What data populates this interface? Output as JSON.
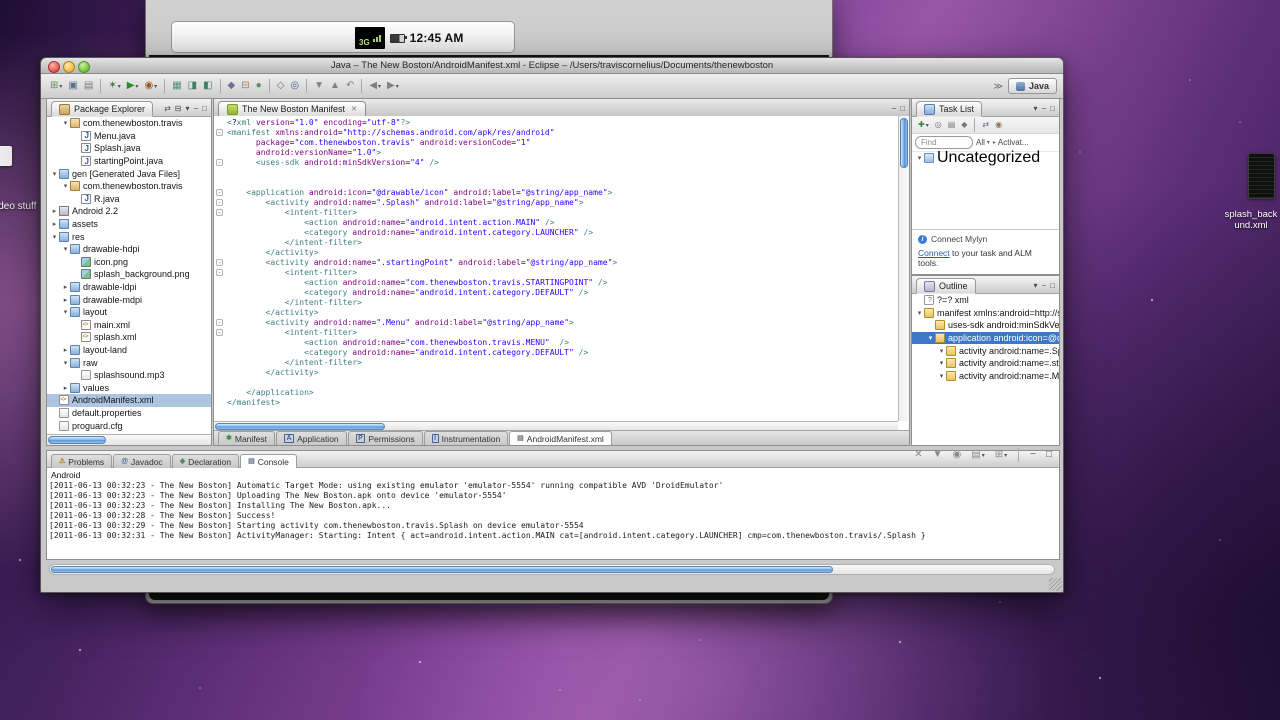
{
  "ui": {
    "menu": "▾",
    "min": "−",
    "max": "□",
    "close": "✕",
    "link": "⇄",
    "collapse_all": "⊟",
    "chevrons": "≫",
    "triangle_down": "▾",
    "triangle_right": "▸",
    "fold": "-"
  },
  "desktop": {
    "left_icon_label": "ideo stuff",
    "right_icon_label_1": "splash_back",
    "right_icon_label_2": "und.xml"
  },
  "emulator": {
    "time": "12:45 AM",
    "signal_label": "3G"
  },
  "window": {
    "title": "Java – The New Boston/AndroidManifest.xml - Eclipse – /Users/traviscornelius/Documents/thenewboston"
  },
  "toolbar": {
    "perspective_label": "Java",
    "icons": [
      {
        "name": "new-wizard",
        "g": "⊞",
        "c": "#6b8f5a",
        "arrow": true
      },
      {
        "name": "save",
        "g": "▣",
        "c": "#5a6f8f"
      },
      {
        "name": "print",
        "g": "▤",
        "c": "#7a7a7a",
        "sep": true
      },
      {
        "name": "debug",
        "g": "✶",
        "c": "#3f7a3f",
        "arrow": true
      },
      {
        "name": "run",
        "g": "▶",
        "c": "#2e8b2e",
        "arrow": true
      },
      {
        "name": "external-tools",
        "g": "◉",
        "c": "#a0522d",
        "arrow": true,
        "sep": true
      },
      {
        "name": "new-android-project",
        "g": "▦",
        "c": "#4f8f6f"
      },
      {
        "name": "android-sdk-manager",
        "g": "◨",
        "c": "#3f7f5f"
      },
      {
        "name": "android-virtual-device-manager",
        "g": "◧",
        "c": "#3f7f5f",
        "sep": true
      },
      {
        "name": "new-java-project",
        "g": "◆",
        "c": "#6f6f9f"
      },
      {
        "name": "new-package",
        "g": "⊟",
        "c": "#9f7f5f"
      },
      {
        "name": "new-class",
        "g": "●",
        "c": "#5f8f5f",
        "sep": true
      },
      {
        "name": "open-type",
        "g": "◇",
        "c": "#6f6f6f"
      },
      {
        "name": "search",
        "g": "◎",
        "c": "#44608f",
        "sep": true
      },
      {
        "name": "next-annotation",
        "g": "▼",
        "c": "#808080"
      },
      {
        "name": "previous-annotation",
        "g": "▲",
        "c": "#808080"
      },
      {
        "name": "last-edit-location",
        "g": "↶",
        "c": "#808080",
        "sep": true
      },
      {
        "name": "back",
        "g": "◀",
        "c": "#808080",
        "arrow": true
      },
      {
        "name": "forward",
        "g": "▶",
        "c": "#808080",
        "arrow": true
      }
    ]
  },
  "package_explorer": {
    "title": "Package Explorer",
    "tree": [
      {
        "d": 1,
        "icon": "package",
        "label": "com.thenewboston.travis",
        "exp": true
      },
      {
        "d": 2,
        "icon": "java",
        "label": "Menu.java"
      },
      {
        "d": 2,
        "icon": "java",
        "label": "Splash.java"
      },
      {
        "d": 2,
        "icon": "java",
        "label": "startingPoint.java"
      },
      {
        "d": 0,
        "icon": "folder",
        "label": "gen [Generated Java Files]",
        "exp": true
      },
      {
        "d": 1,
        "icon": "package",
        "label": "com.thenewboston.travis",
        "exp": true
      },
      {
        "d": 2,
        "icon": "java",
        "label": "R.java"
      },
      {
        "d": 0,
        "icon": "lib",
        "label": "Android 2.2",
        "exp": false
      },
      {
        "d": 0,
        "icon": "folder",
        "label": "assets",
        "exp": false
      },
      {
        "d": 0,
        "icon": "folder",
        "label": "res",
        "exp": true
      },
      {
        "d": 1,
        "icon": "folder",
        "label": "drawable-hdpi",
        "exp": true
      },
      {
        "d": 2,
        "icon": "img",
        "label": "icon.png"
      },
      {
        "d": 2,
        "icon": "img",
        "label": "splash_background.png"
      },
      {
        "d": 1,
        "icon": "folder",
        "label": "drawable-ldpi",
        "exp": false
      },
      {
        "d": 1,
        "icon": "folder",
        "label": "drawable-mdpi",
        "exp": false
      },
      {
        "d": 1,
        "icon": "folder",
        "label": "layout",
        "exp": true
      },
      {
        "d": 2,
        "icon": "xml",
        "label": "main.xml"
      },
      {
        "d": 2,
        "icon": "xml",
        "label": "splash.xml"
      },
      {
        "d": 1,
        "icon": "folder",
        "label": "layout-land",
        "exp": false
      },
      {
        "d": 1,
        "icon": "folder",
        "label": "raw",
        "exp": true
      },
      {
        "d": 2,
        "icon": "file",
        "label": "splashsound.mp3"
      },
      {
        "d": 1,
        "icon": "folder",
        "label": "values",
        "exp": false
      },
      {
        "d": 0,
        "icon": "xml",
        "label": "AndroidManifest.xml",
        "selected": true
      },
      {
        "d": 0,
        "icon": "file",
        "label": "default.properties"
      },
      {
        "d": 0,
        "icon": "file",
        "label": "proguard.cfg"
      }
    ]
  },
  "editor": {
    "tab_label": "The New Boston Manifest",
    "lines": [
      "<?xml version=\"1.0\" encoding=\"utf-8\"?>",
      "<manifest xmlns:android=\"http://schemas.android.com/apk/res/android\"",
      "      package=\"com.thenewboston.travis\" android:versionCode=\"1\"",
      "      android:versionName=\"1.0\">",
      "      <uses-sdk android:minSdkVersion=\"4\" />",
      "",
      "",
      "    <application android:icon=\"@drawable/icon\" android:label=\"@string/app_name\">",
      "        <activity android:name=\".Splash\" android:label=\"@string/app_name\">",
      "            <intent-filter>",
      "                <action android:name=\"android.intent.action.MAIN\" />",
      "                <category android:name=\"android.intent.category.LAUNCHER\" />",
      "            </intent-filter>",
      "        </activity>",
      "        <activity android:name=\".startingPoint\" android:label=\"@string/app_name\">",
      "            <intent-filter>",
      "                <action android:name=\"com.thenewboston.travis.STARTINGPOINT\" />",
      "                <category android:name=\"android.intent.category.DEFAULT\" />",
      "            </intent-filter>",
      "        </activity>",
      "        <activity android:name=\".Menu\" android:label=\"@string/app_name\">",
      "            <intent-filter>",
      "                <action android:name=\"com.thenewboston.travis.MENU\"  />",
      "                <category android:name=\"android.intent.category.DEFAULT\" />",
      "            </intent-filter>",
      "        </activity>",
      "",
      "    </application>",
      "</manifest>"
    ],
    "fold_lines": [
      1,
      4,
      7,
      8,
      9,
      14,
      15,
      20,
      21
    ],
    "bottom_tabs": [
      {
        "label": "Manifest",
        "g": "✱",
        "c": "#3f8f3f"
      },
      {
        "label": "Application",
        "g": "A",
        "c": "#3f5fa0",
        "boxed": true
      },
      {
        "label": "Permissions",
        "g": "P",
        "c": "#3f5fa0",
        "boxed": true
      },
      {
        "label": "Instrumentation",
        "g": "I",
        "c": "#3f5fa0",
        "boxed": true
      },
      {
        "label": "AndroidManifest.xml",
        "g": "▤",
        "c": "#5f6f7f",
        "active": true
      }
    ]
  },
  "task_list": {
    "title": "Task List",
    "toolbar_icons": [
      {
        "name": "new-task",
        "g": "✚",
        "c": "#3f7f3f",
        "arrow": true
      },
      {
        "name": "hide-completed-tasks",
        "g": "◎",
        "c": "#777777"
      },
      {
        "name": "group-by",
        "g": "▤",
        "c": "#777777"
      },
      {
        "name": "filter-tasks",
        "g": "◆",
        "c": "#777777",
        "sep": true
      },
      {
        "name": "synchronize-tasks",
        "g": "⇄",
        "c": "#556699"
      },
      {
        "name": "task-focus",
        "g": "◉",
        "c": "#887755"
      }
    ],
    "find_placeholder": "Find",
    "scope_label": "All",
    "activate_label": "Activat...",
    "uncategorized_label": "Uncategorized",
    "connect_heading": "Connect Mylyn",
    "connect_link": "Connect",
    "connect_rest": " to your task and ALM tools."
  },
  "outline": {
    "title": "Outline",
    "items": [
      {
        "d": 0,
        "icon": "decl",
        "label": "?=? xml"
      },
      {
        "d": 0,
        "icon": "el",
        "label": "manifest xmlns:android=http://s...",
        "exp": true
      },
      {
        "d": 1,
        "icon": "el",
        "label": "uses-sdk android:minSdkVersio..."
      },
      {
        "d": 1,
        "icon": "el",
        "label": "application android:icon=@dr...",
        "exp": true,
        "selected": true
      },
      {
        "d": 2,
        "icon": "el",
        "label": "activity android:name=.Spl...",
        "exp": true
      },
      {
        "d": 2,
        "icon": "el",
        "label": "activity android:name=.sta...",
        "exp": true
      },
      {
        "d": 2,
        "icon": "el",
        "label": "activity android:name=.Me...",
        "exp": true
      }
    ]
  },
  "console": {
    "tabs": [
      {
        "label": "Problems",
        "g": "⚠",
        "c": "#b08000"
      },
      {
        "label": "Javadoc",
        "g": "@",
        "c": "#3f5fa0"
      },
      {
        "label": "Declaration",
        "g": "◈",
        "c": "#4f7f4f"
      },
      {
        "label": "Console",
        "g": "▤",
        "c": "#5f6f7f",
        "active": true
      }
    ],
    "toolbar_icons": [
      {
        "name": "clear-console",
        "g": "✕",
        "c": "#888888"
      },
      {
        "name": "scroll-lock",
        "g": "▼",
        "c": "#888888"
      },
      {
        "name": "pin-console",
        "g": "◉",
        "c": "#888888"
      },
      {
        "name": "display-selected-console",
        "g": "▤",
        "c": "#888888",
        "arrow": true
      },
      {
        "name": "open-console",
        "g": "⊞",
        "c": "#888888",
        "arrow": true,
        "sep": true
      },
      {
        "name": "minimize-view",
        "g": "−",
        "c": "#555555"
      },
      {
        "name": "maximize-view",
        "g": "□",
        "c": "#555555"
      }
    ],
    "console_name": "Android",
    "lines": [
      "[2011-06-13 00:32:23 - The New Boston] Automatic Target Mode: using existing emulator 'emulator-5554' running compatible AVD 'DroidEmulator'",
      "[2011-06-13 00:32:23 - The New Boston] Uploading The New Boston.apk onto device 'emulator-5554'",
      "[2011-06-13 00:32:23 - The New Boston] Installing The New Boston.apk...",
      "[2011-06-13 00:32:28 - The New Boston] Success!",
      "[2011-06-13 00:32:29 - The New Boston] Starting activity com.thenewboston.travis.Splash on device emulator-5554",
      "[2011-06-13 00:32:31 - The New Boston] ActivityManager: Starting: Intent { act=android.intent.action.MAIN cat=[android.intent.category.LAUNCHER] cmp=com.thenewboston.travis/.Splash }"
    ]
  }
}
